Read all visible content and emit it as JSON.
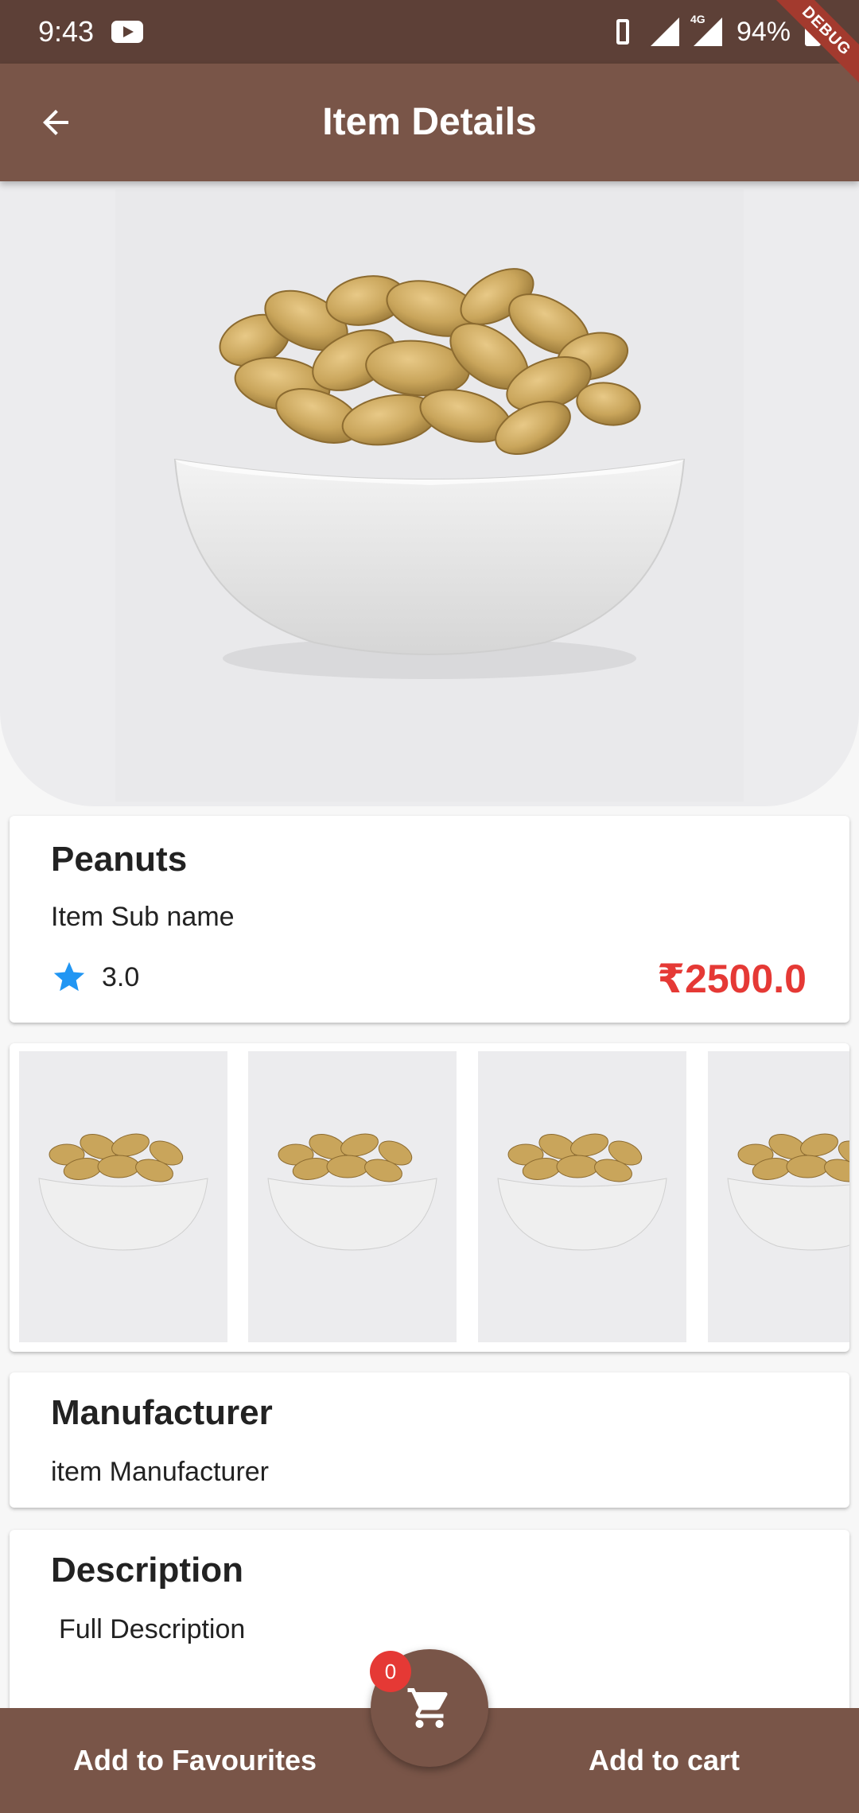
{
  "status_bar": {
    "time": "9:43",
    "network": "4G",
    "battery": "94%"
  },
  "debug_banner": "DEBUG",
  "app_bar": {
    "title": "Item Details"
  },
  "item": {
    "name": "Peanuts",
    "sub_name": "Item Sub name",
    "rating": "3.0",
    "price": "₹2500.0"
  },
  "gallery": {
    "count": 4
  },
  "manufacturer": {
    "title": "Manufacturer",
    "value": "item Manufacturer"
  },
  "description": {
    "title": "Description",
    "value": "Full Description"
  },
  "bottom_bar": {
    "favourites_label": "Add to Favourites",
    "cart_label": "Add to cart",
    "cart_count": "0"
  },
  "colors": {
    "status_bar": "#5d4037",
    "app_bar": "#795548",
    "price": "#e53935",
    "star": "#2196f3",
    "badge": "#e53935"
  },
  "icons": [
    "back-arrow-icon",
    "star-icon",
    "cart-icon",
    "youtube-icon",
    "vibrate-icon",
    "signal-icon",
    "battery-icon"
  ]
}
